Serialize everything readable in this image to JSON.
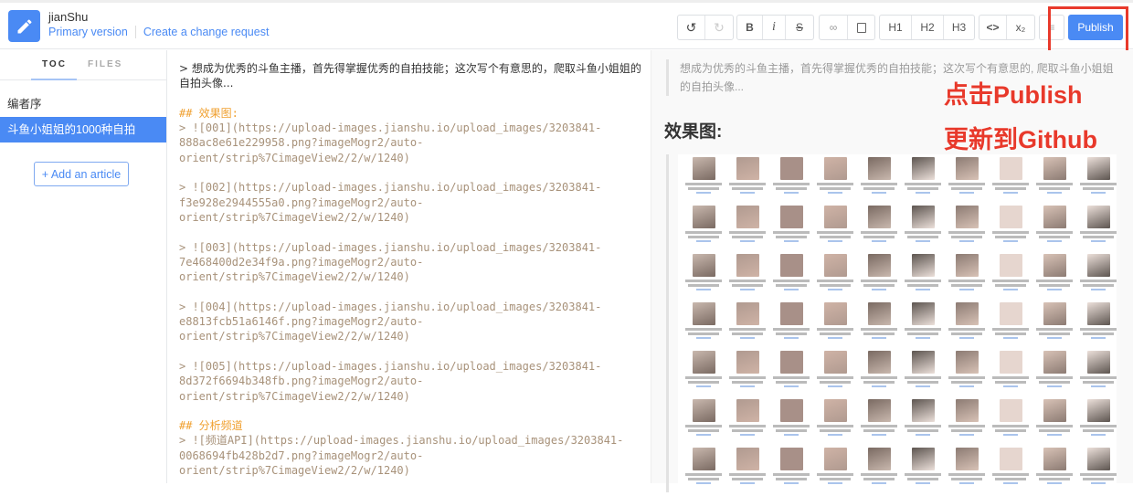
{
  "header": {
    "app_name": "jianShu",
    "primary_version": "Primary version",
    "change_request": "Create a change request",
    "toolbar": {
      "undo": "undo-icon",
      "redo": "redo-icon",
      "bold": "B",
      "italic": "i",
      "strike": "S",
      "link": "link-icon",
      "image": "image-icon",
      "h1": "H1",
      "h2": "H2",
      "h3": "H3",
      "code": "<>",
      "subscript": "x₂",
      "more": "≡"
    },
    "publish": "Publish"
  },
  "sidebar": {
    "tabs": [
      {
        "label": "TOC"
      },
      {
        "label": "FILES"
      }
    ],
    "items": [
      {
        "label": "编者序"
      },
      {
        "label": "斗鱼小姐姐的1000种自拍"
      }
    ],
    "add_article": "+ Add an article"
  },
  "editor": {
    "intro": "> 想成为优秀的斗鱼主播，首先得掌握优秀的自拍技能；这次写个有意思的，爬取斗鱼小姐姐的\n自拍头像...",
    "heading1": "## 效果图:",
    "blocks": [
      "> ![001](https://upload-images.jianshu.io/upload_images/3203841-\n888ac8e61e229958.png?imageMogr2/auto-\norient/strip%7CimageView2/2/w/1240)",
      "> ![002](https://upload-images.jianshu.io/upload_images/3203841-\nf3e928e2944555a0.png?imageMogr2/auto-\norient/strip%7CimageView2/2/w/1240)",
      "> ![003](https://upload-images.jianshu.io/upload_images/3203841-\n7e468400d2e34f9a.png?imageMogr2/auto-\norient/strip%7CimageView2/2/w/1240)",
      "> ![004](https://upload-images.jianshu.io/upload_images/3203841-\ne8813fcb51a6146f.png?imageMogr2/auto-\norient/strip%7CimageView2/2/w/1240)",
      "> ![005](https://upload-images.jianshu.io/upload_images/3203841-\n8d372f6694b348fb.png?imageMogr2/auto-\norient/strip%7CimageView2/2/w/1240)"
    ],
    "heading2": "## 分析频道",
    "api_block": "> ![频道API](https://upload-images.jianshu.io/upload_images/3203841-\n0068694fb428b2d7.png?imageMogr2/auto-\norient/strip%7CimageView2/2/w/1240)"
  },
  "preview": {
    "quote": "想成为优秀的斗鱼主播，首先得掌握优秀的自拍技能；这次写个有意思的, 爬取斗鱼小姐姐的自拍头像...",
    "heading": "效果图:"
  },
  "annotations": {
    "line1": "点击Publish",
    "line2": "更新到Github",
    "color": "#e8392b"
  },
  "colors": {
    "accent": "#4a8af4",
    "heading": "#f0a030",
    "url": "#a8927a"
  }
}
